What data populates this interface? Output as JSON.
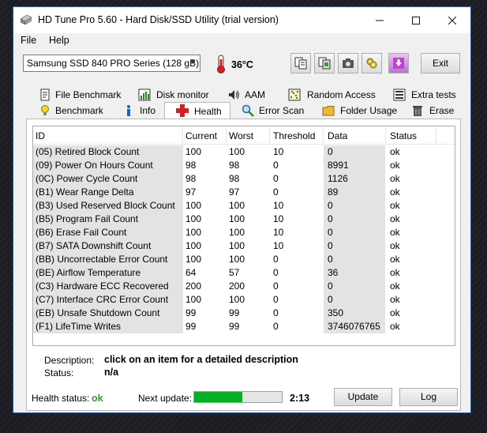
{
  "window": {
    "title": "HD Tune Pro 5.60 - Hard Disk/SSD Utility (trial version)",
    "minimize_icon": "minimize-icon",
    "maximize_icon": "maximize-icon",
    "close_icon": "close-icon"
  },
  "menu": {
    "file": "File",
    "help": "Help"
  },
  "toolbar": {
    "drive": "Samsung SSD 840 PRO Series (128 gB)",
    "temperature": "36°C",
    "exit_label": "Exit",
    "icons": [
      "copy-text-icon",
      "copy-screenshot-icon",
      "camera-icon",
      "options-icon",
      "save-icon"
    ]
  },
  "tabs": {
    "row1": [
      "File Benchmark",
      "Disk monitor",
      "AAM",
      "Random Access",
      "Extra tests"
    ],
    "row2": [
      "Benchmark",
      "Info",
      "Health",
      "Error Scan",
      "Folder Usage",
      "Erase"
    ],
    "active": "Health"
  },
  "health_table": {
    "columns": [
      "ID",
      "Current",
      "Worst",
      "Threshold",
      "Data",
      "Status"
    ],
    "rows": [
      {
        "id": "(05) Retired Block Count",
        "current": "100",
        "worst": "100",
        "threshold": "10",
        "data": "0",
        "status": "ok"
      },
      {
        "id": "(09) Power On Hours Count",
        "current": "98",
        "worst": "98",
        "threshold": "0",
        "data": "8991",
        "status": "ok"
      },
      {
        "id": "(0C) Power Cycle Count",
        "current": "98",
        "worst": "98",
        "threshold": "0",
        "data": "1126",
        "status": "ok"
      },
      {
        "id": "(B1) Wear Range Delta",
        "current": "97",
        "worst": "97",
        "threshold": "0",
        "data": "89",
        "status": "ok"
      },
      {
        "id": "(B3) Used Reserved Block Count",
        "current": "100",
        "worst": "100",
        "threshold": "10",
        "data": "0",
        "status": "ok"
      },
      {
        "id": "(B5) Program Fail Count",
        "current": "100",
        "worst": "100",
        "threshold": "10",
        "data": "0",
        "status": "ok"
      },
      {
        "id": "(B6) Erase Fail Count",
        "current": "100",
        "worst": "100",
        "threshold": "10",
        "data": "0",
        "status": "ok"
      },
      {
        "id": "(B7) SATA Downshift Count",
        "current": "100",
        "worst": "100",
        "threshold": "10",
        "data": "0",
        "status": "ok"
      },
      {
        "id": "(BB) Uncorrectable Error Count",
        "current": "100",
        "worst": "100",
        "threshold": "0",
        "data": "0",
        "status": "ok"
      },
      {
        "id": "(BE) Airflow Temperature",
        "current": "64",
        "worst": "57",
        "threshold": "0",
        "data": "36",
        "status": "ok"
      },
      {
        "id": "(C3) Hardware ECC Recovered",
        "current": "200",
        "worst": "200",
        "threshold": "0",
        "data": "0",
        "status": "ok"
      },
      {
        "id": "(C7) Interface CRC Error Count",
        "current": "100",
        "worst": "100",
        "threshold": "0",
        "data": "0",
        "status": "ok"
      },
      {
        "id": "(EB) Unsafe Shutdown Count",
        "current": "99",
        "worst": "99",
        "threshold": "0",
        "data": "350",
        "status": "ok"
      },
      {
        "id": "(F1) LifeTime Writes",
        "current": "99",
        "worst": "99",
        "threshold": "0",
        "data": "3746076765",
        "status": "ok"
      }
    ]
  },
  "details": {
    "description_label": "Description:",
    "description_value": "click on an item for a detailed description",
    "status_label": "Status:",
    "status_value": "n/a"
  },
  "footer": {
    "health_status_label": "Health status:",
    "health_status_value": "ok",
    "health_status_color": "#2aa52a",
    "next_update_label": "Next update:",
    "next_update_progress": 0.55,
    "progress_color": "#06b025",
    "timer": "2:13",
    "update_label": "Update",
    "log_label": "Log"
  }
}
